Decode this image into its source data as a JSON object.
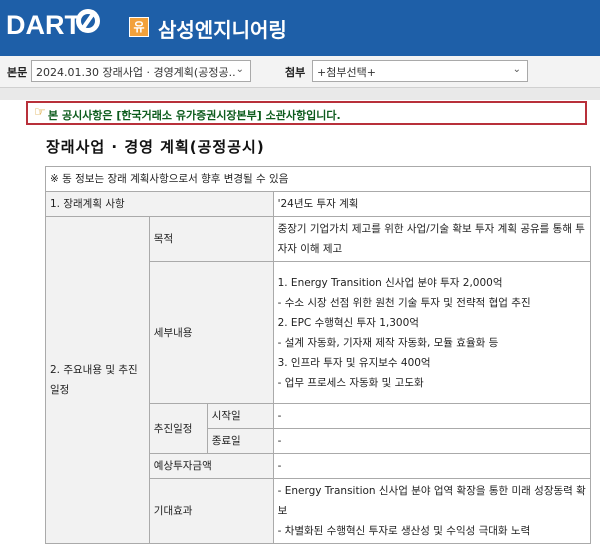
{
  "header": {
    "logo_text": "DART",
    "badge": "유",
    "company": "삼성엔지니어링"
  },
  "selectors": {
    "report_label": "본문",
    "report_value": "2024.01.30  장래사업 · 경영계획(공정공..",
    "attach_label": "첨부",
    "attach_value": "+첨부선택+"
  },
  "notice": {
    "text": "본 공시사항은 [한국거래소 유가증권시장본부] 소관사항입니다."
  },
  "document": {
    "title": "장래사업 · 경영 계획(공정공시)",
    "disclaimer": "※ 동 정보는 장래 계획사항으로서 향후 변경될 수 있음",
    "row1_label": "1. 장래계획 사항",
    "row1_value": "'24년도 투자 계획",
    "section2_label": "2. 주요내용 및 추진일정",
    "purpose_label": "목적",
    "purpose_value": "중장기 기업가치 제고를 위한 사업/기술 확보 투자 계획 공유를 통해 투자자 이해 제고",
    "details_label": "세부내용",
    "details_lines": [
      "1. Energy Transition 신사업 분야 투자 2,000억",
      "- 수소 시장 선점 위한 원천 기술 투자 및 전략적 협업 추진",
      "2. EPC 수행혁신 투자 1,300억",
      "- 설계 자동화, 기자재 제작 자동화, 모듈 효율화 등",
      "3. 인프라 투자 및 유지보수 400억",
      "- 업무 프로세스 자동화 및 고도화"
    ],
    "schedule_label": "추진일정",
    "start_label": "시작일",
    "start_value": "-",
    "end_label": "종료일",
    "end_value": "-",
    "investment_label": "예상투자금액",
    "investment_value": "-",
    "effect_label": "기대효과",
    "effect_lines": [
      "- Energy Transition 신사업 분야 업역 확장을 통한 미래 성장동력 확보",
      "- 차별화된 수행혁신 투자로 생산성 및 수익성 극대화 노력"
    ]
  },
  "colors": {
    "header_bg": "#1e5fa8",
    "notice_border": "#b8303a",
    "notice_text": "#0c5b1c"
  }
}
